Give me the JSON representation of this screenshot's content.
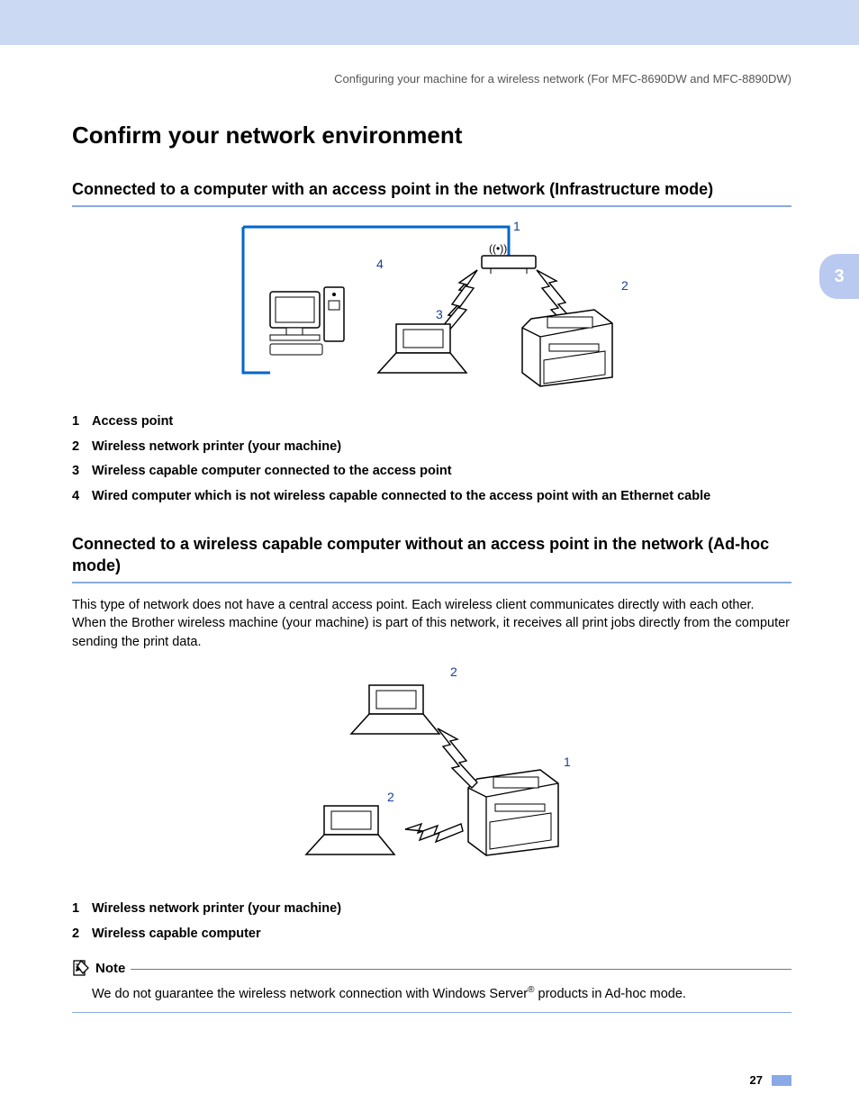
{
  "header_path": "Configuring your machine for a wireless network (For MFC-8690DW and MFC-8890DW)",
  "chapter_tab": "3",
  "title": "Confirm your network environment",
  "section1": {
    "heading": "Connected to a computer with an access point in the network (Infrastructure mode)",
    "labels": {
      "l1": "1",
      "l2": "2",
      "l3": "3",
      "l4": "4"
    },
    "legend": [
      {
        "n": "1",
        "t": "Access point"
      },
      {
        "n": "2",
        "t": "Wireless network printer (your machine)"
      },
      {
        "n": "3",
        "t": "Wireless capable computer connected to the access point"
      },
      {
        "n": "4",
        "t": "Wired computer which is not wireless capable connected to the access point with an Ethernet cable"
      }
    ]
  },
  "section2": {
    "heading": "Connected to a wireless capable computer without an access point in the network (Ad-hoc mode)",
    "intro": "This type of network does not have a central access point. Each wireless client communicates directly with each other. When the Brother wireless machine (your machine) is part of this network, it receives all print jobs directly from the computer sending the print data.",
    "labels": {
      "l1": "1",
      "l2a": "2",
      "l2b": "2"
    },
    "legend": [
      {
        "n": "1",
        "t": "Wireless network printer (your machine)"
      },
      {
        "n": "2",
        "t": "Wireless capable computer"
      }
    ]
  },
  "note": {
    "label": "Note",
    "text_a": "We do not guarantee the wireless network connection with Windows Server",
    "text_b": " products in Ad-hoc mode.",
    "reg": "®"
  },
  "page_number": "27"
}
